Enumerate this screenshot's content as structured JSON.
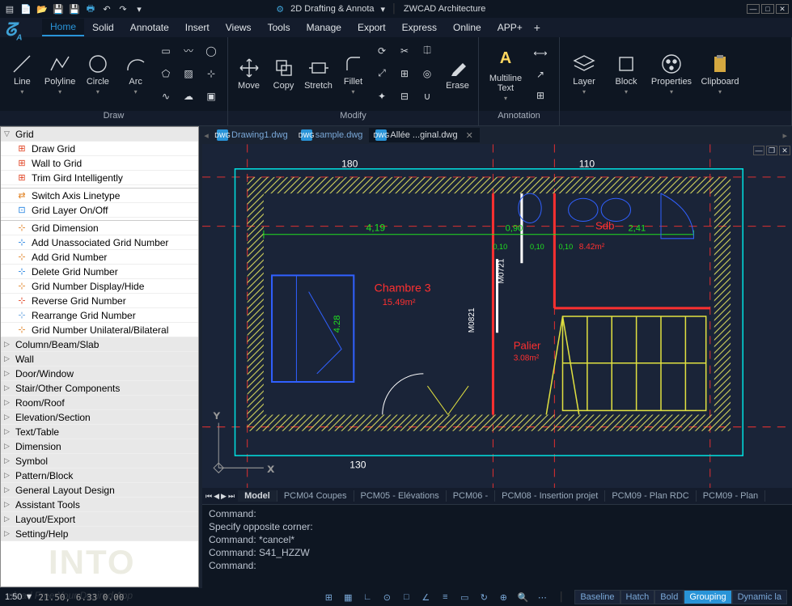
{
  "titlebar": {
    "workspace": "2D Drafting & Annota",
    "app_name": "ZWCAD Architecture"
  },
  "menu_tabs": [
    "Home",
    "Solid",
    "Annotate",
    "Insert",
    "Views",
    "Tools",
    "Manage",
    "Export",
    "Express",
    "Online",
    "APP+"
  ],
  "menu_active": 0,
  "ribbon": {
    "draw": {
      "title": "Draw",
      "line": "Line",
      "polyline": "Polyline",
      "circle": "Circle",
      "arc": "Arc"
    },
    "modify": {
      "title": "Modify",
      "move": "Move",
      "copy": "Copy",
      "stretch": "Stretch",
      "fillet": "Fillet",
      "erase": "Erase"
    },
    "annotation": {
      "title": "Annotation",
      "mtext": "Multiline\nText"
    },
    "other": {
      "layer": "Layer",
      "block": "Block",
      "properties": "Properties",
      "clipboard": "Clipboard"
    }
  },
  "left_tree": {
    "grid_header": "Grid",
    "grid_items": [
      "Draw Grid",
      "Wall to Grid",
      "Trim Gird Intelligently"
    ],
    "axis_items": [
      "Switch Axis Linetype",
      "Grid Layer On/Off"
    ],
    "dim_items": [
      "Grid Dimension",
      "Add Unassociated Grid Number",
      "Add Grid Number",
      "Delete Grid Number",
      "Grid Number Display/Hide",
      "Reverse Grid Number",
      "Rearrange Grid Number",
      "Grid Number Unilateral/Bilateral"
    ],
    "sections": [
      "Column/Beam/Slab",
      "Wall",
      "Door/Window",
      "Stair/Other Components",
      "Room/Roof",
      "Elevation/Section",
      "Text/Table",
      "Dimension",
      "Symbol",
      "Pattern/Block",
      "General Layout Design",
      "Assistant Tools",
      "Layout/Export",
      "Setting/Help"
    ]
  },
  "drawing_tabs": [
    {
      "label": "Drawing1.dwg",
      "active": false
    },
    {
      "label": "sample.dwg",
      "active": false
    },
    {
      "label": "Allée ...ginal.dwg",
      "active": true
    }
  ],
  "plan": {
    "dim_top_left": "180",
    "dim_top_right": "110",
    "dim_green_w": "4,19",
    "dim_green_r1": "0,90",
    "dim_green_r2": "2,41",
    "dim_sm1": "0,10",
    "dim_sm2": "0,10",
    "dim_sm3": "0,10",
    "sdb_label": "Sdb",
    "sdb_area": "8.42m²",
    "room_label": "Chambre 3",
    "room_area": "15.49m²",
    "palier_label": "Palier",
    "palier_area": "3.08m²",
    "col1": "M0721",
    "col2": "M0821",
    "dim_bottom": "130",
    "dim_left": "4.28"
  },
  "model_tabs": [
    "Model",
    "PCM04 Coupes",
    "PCM05 - Elévations",
    "PCM06 -",
    "PCM08 - Insertion projet",
    "PCM09 - Plan RDC",
    "PCM09 - Plan"
  ],
  "model_active": 0,
  "command_lines": [
    "Command:",
    "Specify opposite corner:",
    "Command: *cancel*",
    "Command: S41_HZZW",
    "Command:"
  ],
  "status": {
    "scale": "1:50 ▼",
    "coord": "21.50, 6.33  0.00",
    "textbtns": [
      "Baseline",
      "Hatch",
      "Bold",
      "Grouping",
      "Dynamic la"
    ],
    "textbtns_on": 3
  },
  "watermark": "INTO",
  "watermark2": "nload Free Your Desired App"
}
